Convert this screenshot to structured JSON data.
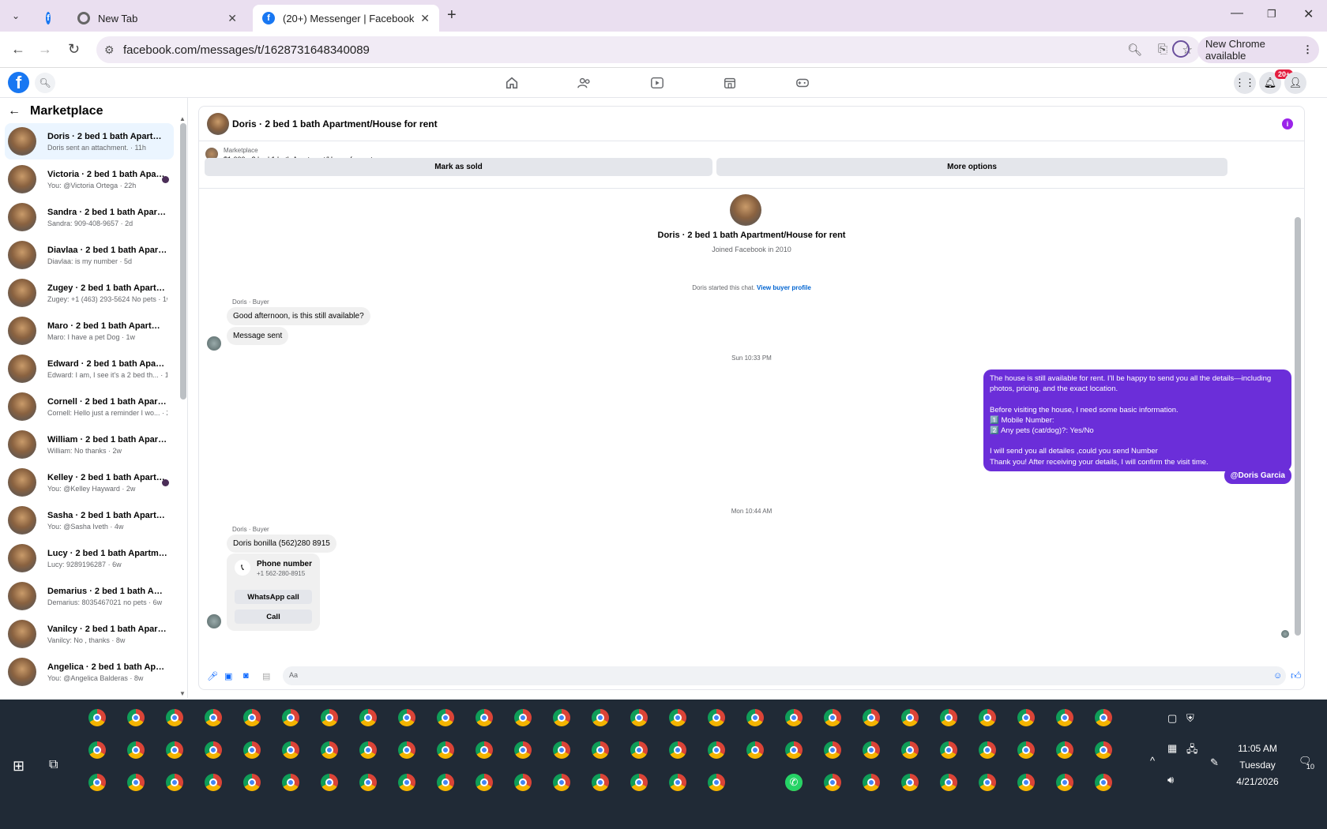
{
  "browser": {
    "tabs": [
      {
        "title": "",
        "icon": "facebook-icon"
      },
      {
        "title": "New Tab",
        "icon": "chrome-icon"
      },
      {
        "title": "(20+) Messenger | Facebook",
        "icon": "facebook-icon",
        "active": true
      }
    ],
    "url": "facebook.com/messages/t/1628731648340089",
    "update_label": "New Chrome available"
  },
  "facebook": {
    "notification_badge": "20+"
  },
  "sidebar": {
    "title": "Marketplace",
    "conversations": [
      {
        "name": "Doris · 2 bed 1 bath Apartment...",
        "preview": "Doris sent an attachment. · 11h",
        "active": true
      },
      {
        "name": "Victoria · 2 bed 1 bath Apart...",
        "preview": "You: @Victoria Ortega · 22h",
        "dot": true
      },
      {
        "name": "Sandra · 2 bed 1 bath Apartme...",
        "preview": "Sandra: 909-408-9657 · 2d"
      },
      {
        "name": "Diavlaa · 2 bed 1 bath Apartme...",
        "preview": "Diavlaa: is my number · 5d"
      },
      {
        "name": "Zugey · 2 bed 1 bath Apartmen...",
        "preview": "Zugey: +1 (463) 293-5624 No pets · 1w"
      },
      {
        "name": "Maro · 2 bed 1 bath Apartment...",
        "preview": "Maro: I have a pet Dog · 1w"
      },
      {
        "name": "Edward · 2 bed 1 bath Apartme...",
        "preview": "Edward: I am, I see it's a 2 bed th... · 1w"
      },
      {
        "name": "Cornell · 2 bed 1 bath Apartme...",
        "preview": "Cornell: Hello just a reminder I wo... · 2w"
      },
      {
        "name": "William · 2 bed 1 bath Apartme...",
        "preview": "William: No thanks · 2w"
      },
      {
        "name": "Kelley · 2 bed 1 bath Apartm...",
        "preview": "You: @Kelley Hayward · 2w",
        "dot": true
      },
      {
        "name": "Sasha · 2 bed 1 bath Apartment...",
        "preview": "You: @Sasha Iveth · 4w"
      },
      {
        "name": "Lucy · 2 bed 1 bath Apartment/...",
        "preview": "Lucy: 9289196287 · 6w"
      },
      {
        "name": "Demarius · 2 bed 1 bath Apart...",
        "preview": "Demarius: 8035467021 no pets · 6w"
      },
      {
        "name": "Vanilcy · 2 bed 1 bath Apartme...",
        "preview": "Vanilcy: No , thanks · 8w"
      },
      {
        "name": "Angelica · 2 bed 1 bath Apartm...",
        "preview": "You: @Angelica Balderas · 8w"
      }
    ]
  },
  "chat": {
    "title": "Doris · 2 bed 1 bath Apartment/House for rent",
    "listing_label": "Marketplace",
    "listing_price": "$1,000 · 2 bed 1 bath Apartment/House for rent",
    "mark_sold": "Mark as sold",
    "more_options": "More options",
    "profile_name": "Doris · 2 bed 1 bath Apartment/House for rent",
    "profile_sub": "Joined Facebook in 2010",
    "started_text": "Doris started this chat.",
    "view_profile": "View buyer profile",
    "sender_label": "Doris · Buyer",
    "msg1": "Good afternoon, is this still available?",
    "msg2": "Message sent",
    "time1": "Sun 10:33 PM",
    "outgoing": "The house is still available for rent. I'll be happy to send you all the details—including photos, pricing, and the exact location.\n\nBefore visiting the house, I need some basic information.\n1️⃣ Mobile Number:\n2️⃣ Any pets (cat/dog)?: Yes/No\n\nI will send you all detailes ,could you send Number\nThank you! After receiving your details, I will confirm the visit time.",
    "mention": "@Doris Garcia",
    "time2": "Mon 10:44 AM",
    "sender_label2": "Doris · Buyer",
    "msg3": "Doris bonilla (562)280 8915",
    "card_title": "Phone number",
    "card_number": "+1 562-280-8915",
    "whatsapp": "WhatsApp call",
    "call": "Call",
    "composer_placeholder": "Aa"
  },
  "taskbar": {
    "time": "11:05 AM",
    "day": "Tuesday",
    "date": "4/21/2026",
    "notif_count": "10"
  },
  "colors": {
    "accent": "#6b2ed9",
    "fb_blue": "#1877f2"
  }
}
